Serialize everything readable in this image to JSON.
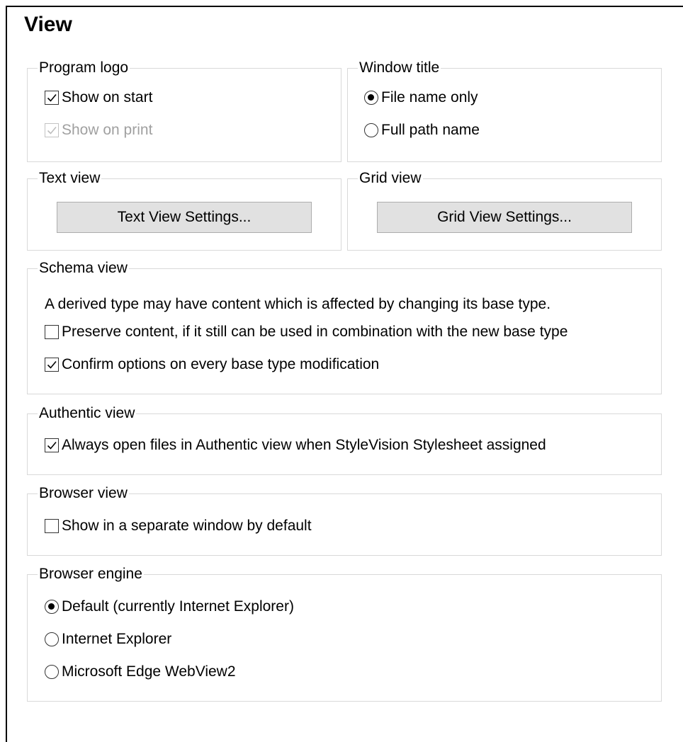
{
  "heading": "View",
  "program_logo": {
    "legend": "Program logo",
    "show_on_start": {
      "label": "Show on start",
      "checked": true
    },
    "show_on_print": {
      "label": "Show on print",
      "checked": true,
      "disabled": true
    }
  },
  "window_title": {
    "legend": "Window title",
    "options": [
      {
        "label": "File name only",
        "selected": true
      },
      {
        "label": "Full path name",
        "selected": false
      }
    ]
  },
  "text_view": {
    "legend": "Text view",
    "button_label": "Text View Settings..."
  },
  "grid_view": {
    "legend": "Grid view",
    "button_label": "Grid View Settings..."
  },
  "schema_view": {
    "legend": "Schema view",
    "description": "A derived type may have content which is affected by changing its base type.",
    "preserve_content": {
      "label": "Preserve content, if it still can be used in combination with the new base type",
      "checked": false
    },
    "confirm_options": {
      "label": "Confirm options on every base type modification",
      "checked": true
    }
  },
  "authentic_view": {
    "legend": "Authentic view",
    "always_open": {
      "label": "Always open files in Authentic view when StyleVision Stylesheet assigned",
      "checked": true
    }
  },
  "browser_view": {
    "legend": "Browser view",
    "separate_window": {
      "label": "Show in a separate window by default",
      "checked": false
    }
  },
  "browser_engine": {
    "legend": "Browser engine",
    "options": [
      {
        "label": "Default (currently Internet Explorer)",
        "selected": true
      },
      {
        "label": "Internet Explorer",
        "selected": false
      },
      {
        "label": "Microsoft Edge WebView2",
        "selected": false
      }
    ]
  }
}
